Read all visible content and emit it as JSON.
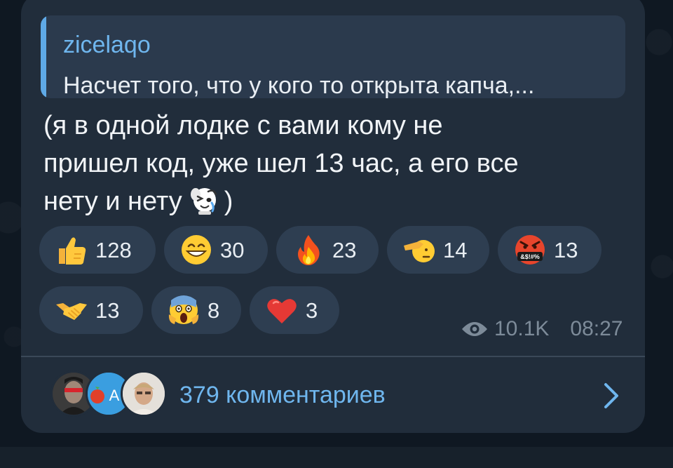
{
  "reply": {
    "author": "zicelaqo",
    "text": "Насчет того, что у кого то открыта капча,..."
  },
  "message": {
    "lines": [
      "(я в одной лодке с вами кому не",
      "пришел код, уже шел 13 час, а его все",
      "нету и нету"
    ],
    "closing": ")",
    "inline_icon": "crying-dog-sticker-icon"
  },
  "reactions": [
    {
      "icon": "thumbs-up-icon",
      "count": "128"
    },
    {
      "icon": "grinning-face-icon",
      "count": "30"
    },
    {
      "icon": "fire-icon",
      "count": "23"
    },
    {
      "icon": "saluting-face-icon",
      "count": "14"
    },
    {
      "icon": "cursing-face-icon",
      "count": "13",
      "icon_text": "&$!#%"
    },
    {
      "icon": "handshake-icon",
      "count": "13"
    },
    {
      "icon": "screaming-face-icon",
      "count": "8"
    },
    {
      "icon": "red-heart-icon",
      "count": "3"
    }
  ],
  "meta": {
    "views": "10.1K",
    "time": "08:27",
    "views_icon": "eye-icon"
  },
  "comments": {
    "label": "379 комментариев",
    "avatar_letter": "A",
    "chevron_icon": "chevron-right-icon"
  },
  "colors": {
    "bubble": "#212d3b",
    "reply_bg": "#2b3a4d",
    "accent": "#6fb6ee",
    "reaction_bg": "#2e3e51",
    "meta_text": "#7d8b99"
  }
}
